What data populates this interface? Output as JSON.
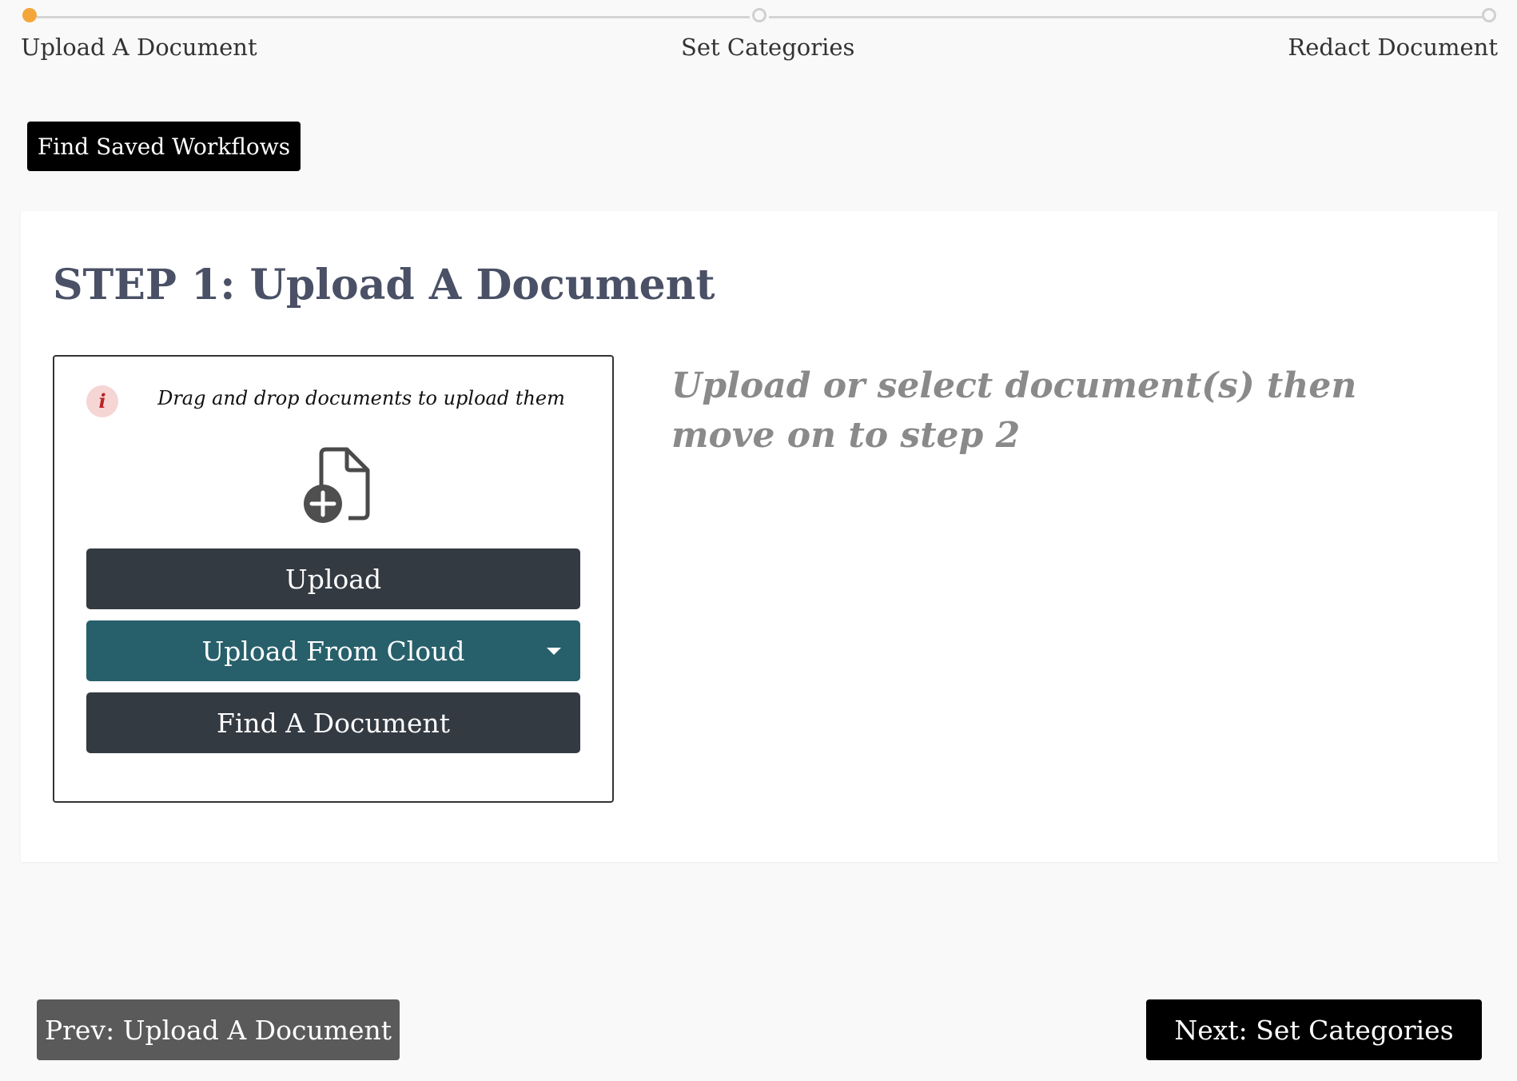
{
  "stepper": {
    "steps": [
      {
        "label": "Upload A Document",
        "state": "active"
      },
      {
        "label": "Set Categories",
        "state": "pending"
      },
      {
        "label": "Redact Document",
        "state": "pending"
      }
    ],
    "active_color": "#f4a63a"
  },
  "saved_workflows_label": "Find Saved Workflows",
  "step": {
    "title": "STEP 1: Upload A Document",
    "drag_hint": "Drag and drop documents to upload them",
    "info_icon_glyph": "i",
    "upload_label": "Upload",
    "cloud_label": "Upload From Cloud",
    "find_label": "Find A Document",
    "instruction": "Upload or select document(s) then move on to step 2"
  },
  "footer": {
    "prev_label": "Prev: Upload A Document",
    "next_label": "Next: Set Categories"
  },
  "colors": {
    "title": "#4a5065",
    "dark_button": "#343a42",
    "cloud_button": "#27606b"
  }
}
